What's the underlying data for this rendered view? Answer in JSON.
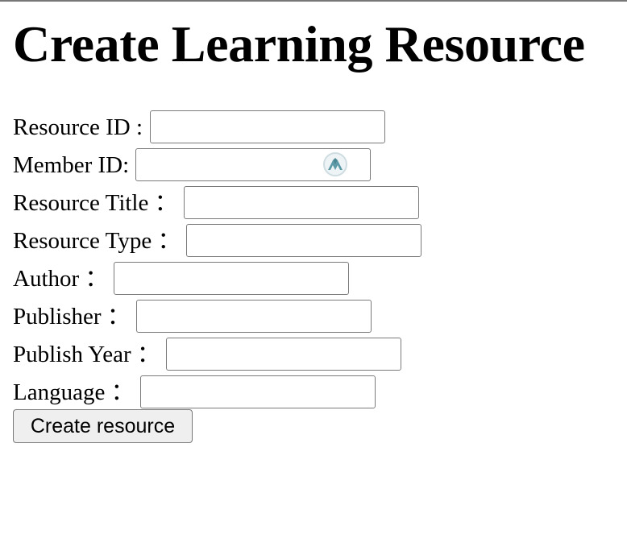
{
  "page": {
    "title": "Create Learning Resource"
  },
  "form": {
    "fields": [
      {
        "label": "Resource ID :",
        "value": "",
        "placeholder": ""
      },
      {
        "label": "Member ID:",
        "value": "",
        "placeholder": "",
        "icon": "nordpass-extension-icon"
      },
      {
        "label": "Resource Title ：",
        "value": "",
        "placeholder": ""
      },
      {
        "label": "Resource Type ：",
        "value": "",
        "placeholder": ""
      },
      {
        "label": "Author ：",
        "value": "",
        "placeholder": ""
      },
      {
        "label": "Publisher ：",
        "value": "",
        "placeholder": ""
      },
      {
        "label": "Publish Year ：",
        "value": "",
        "placeholder": ""
      },
      {
        "label": "Language ：",
        "value": "",
        "placeholder": ""
      }
    ],
    "submit_label": "Create resource"
  },
  "colors": {
    "text": "#000000",
    "border": "#7a7a7a",
    "button_background": "#efefef",
    "extension_icon_teal": "#5c9aa7"
  }
}
